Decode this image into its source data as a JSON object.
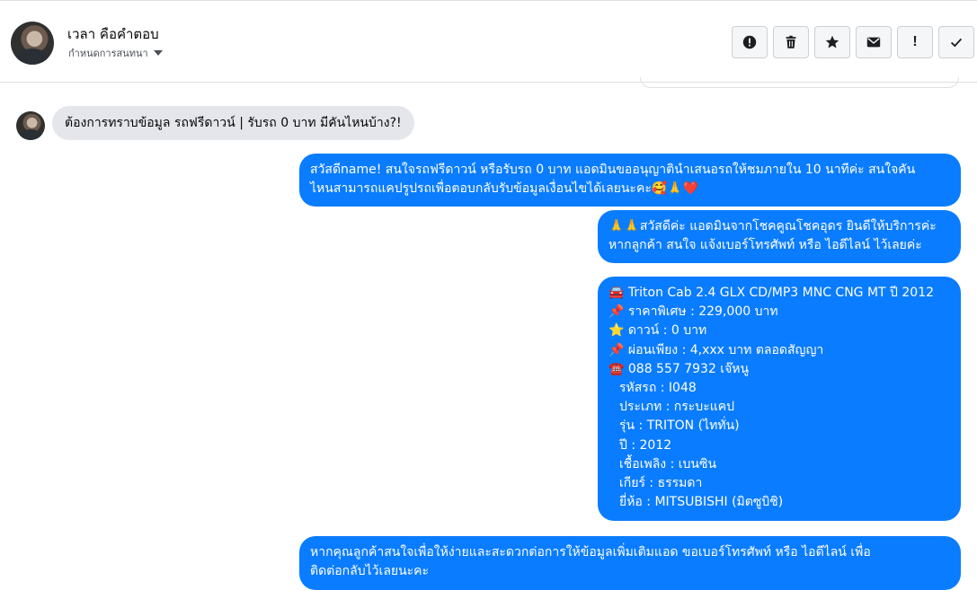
{
  "header": {
    "contact_name": "เวลา คือคำตอบ",
    "assign_label": "กำหนดการสนทนา",
    "toolbar": [
      {
        "name": "spam-button",
        "icon": "alert-circle-icon"
      },
      {
        "name": "delete-button",
        "icon": "trash-icon"
      },
      {
        "name": "star-button",
        "icon": "star-icon"
      },
      {
        "name": "mark-unread-button",
        "icon": "envelope-icon"
      },
      {
        "name": "priority-button",
        "icon": "exclamation-icon",
        "glyph": "!"
      },
      {
        "name": "done-button",
        "icon": "checkmark-icon"
      }
    ]
  },
  "messages": {
    "incoming_1": "ต้องการทราบข้อมูล รถฟรีดาวน์ | รับรถ 0 บาท มีคันไหนบ้าง?!",
    "outgoing_1": [
      "สวัสดีname! สนใจรถฟรีดาวน์ หรือรับรถ 0 บาท แอดมินขออนุญาตินำเสนอรถให้ชมภายใน 10 นาทีค่ะ สนใจคัน",
      "ไหนสามารถแคปรูปรถเพื่อตอบกลับรับข้อมูลเงื่อนไขได้เลยนะคะ🥰🙏❤️"
    ],
    "outgoing_2": [
      "🙏🙏สวัสดีค่ะ แอดมินจากโชคคูณโชคอุดร ยินดีให้บริการค่ะ",
      "หากลูกค้า สนใจ แจ้งเบอร์โทรศัพท์ หรือ ไอดีไลน์  ไว้เลยค่ะ"
    ],
    "outgoing_3": [
      "🚘 Triton Cab 2.4 GLX CD/MP3 MNC  CNG MT ปี 2012",
      "📌 ราคาพิเศษ : 229,000 บาท",
      "⭐ ดาวน์ : 0 บาท",
      "📌 ผ่อนเพียง : 4,xxx บาท ตลอดสัญญา",
      "☎️ 088 557 7932 เจ๊หนู",
      "รหัสรถ : I048",
      "ประเภท : กระบะแคป",
      "รุ่น : TRITON (ไททั่น)",
      "ปี : 2012",
      "เชื้อเพลิง : เบนซิน",
      "เกียร์ : ธรรมดา",
      "ยี่ห้อ : MITSUBISHI (มิตซูบิชิ)"
    ],
    "outgoing_4": [
      "หากคุณลูกค้าสนใจเพื่อให้ง่ายและสะดวกต่อการให้ข้อมูลเพิ่มเติมแอด ขอเบอร์โทรศัพท์ หรือ ไอดีไลน์ เพื่อ",
      "ติดต่อกลับไว้เลยนะคะ"
    ]
  },
  "colors": {
    "outgoing_bubble": "#0a7cff",
    "incoming_bubble": "#e4e6eb",
    "toolbar_button_bg": "#f5f6f7"
  }
}
